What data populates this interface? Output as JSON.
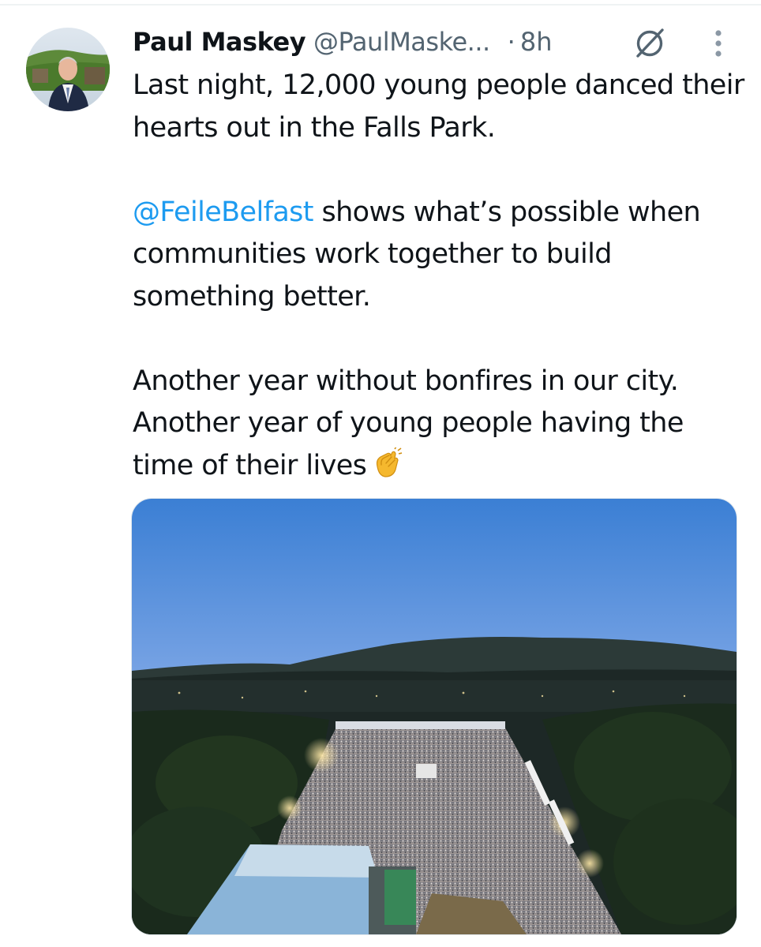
{
  "tweet": {
    "author": {
      "display_name": "Paul Maskey",
      "handle": "@PaulMaske...",
      "avatar_icon": "avatar-photo"
    },
    "separator": "·",
    "time": "8h",
    "grok_icon": "grok-slash-circle-icon",
    "more_icon": "vertical-ellipsis-icon",
    "text": {
      "line1": "Last night, 12,000 young people danced their hearts out in the Falls Park.",
      "mention": "@FeileBelfast",
      "para2_rest": " shows what’s possible when communities work together to build something better.",
      "para3_line1": "Another year without bonfires in our city.",
      "para3_line2": "Another year of young people having the time of their lives",
      "emoji": "clapping-hands-emoji"
    },
    "media": {
      "type": "photo",
      "subject_icon": "aerial-concert-crowd-at-dusk"
    }
  },
  "colors": {
    "text": "#0f1419",
    "secondary": "#536471",
    "link": "#1d9bf0",
    "background": "#ffffff"
  }
}
